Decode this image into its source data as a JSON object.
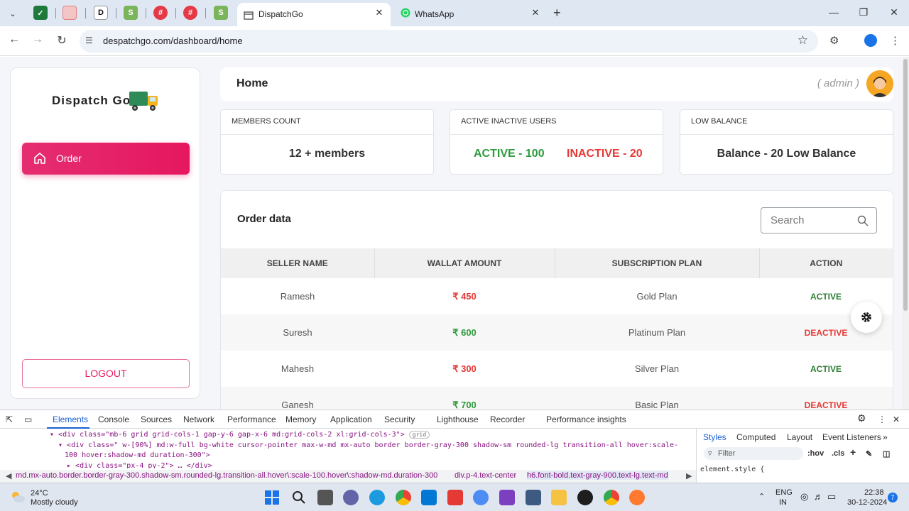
{
  "browser": {
    "tabs": [
      {
        "title": "DispatchGo",
        "active": true
      },
      {
        "title": "WhatsApp",
        "active": false
      }
    ],
    "url": "despatchgo.com/dashboard/home"
  },
  "sidebar": {
    "brand": "Dispatch Go",
    "nav": [
      {
        "label": "Order",
        "icon": "home-icon"
      }
    ],
    "logout_label": "LOGOUT"
  },
  "header": {
    "title": "Home",
    "user_role": "( admin )"
  },
  "stats": [
    {
      "title": "MEMBERS COUNT",
      "value": "12 + members"
    },
    {
      "title": "ACTIVE INACTIVE USERS",
      "active": "ACTIVE - 100",
      "inactive": "INACTIVE - 20"
    },
    {
      "title": "LOW BALANCE",
      "value": "Balance - 20 Low Balance"
    }
  ],
  "orders": {
    "title": "Order data",
    "search_placeholder": "Search",
    "columns": [
      "SELLER NAME",
      "WALLAT AMOUNT",
      "SUBSCRIPTION PLAN",
      "ACTION"
    ],
    "rows": [
      {
        "seller": "Ramesh",
        "amount": "₹ 450",
        "plan": "Gold Plan",
        "action": "ACTIVE"
      },
      {
        "seller": "Suresh",
        "amount": "₹ 600",
        "plan": "Platinum Plan",
        "action": "DEACTIVE"
      },
      {
        "seller": "Mahesh",
        "amount": "₹ 300",
        "plan": "Silver Plan",
        "action": "ACTIVE"
      },
      {
        "seller": "Ganesh",
        "amount": "₹ 700",
        "plan": "Basic Plan",
        "action": "DEACTIVE"
      }
    ]
  },
  "devtools": {
    "tabs": [
      "Elements",
      "Console",
      "Sources",
      "Network",
      "Performance",
      "Memory",
      "Application",
      "Security",
      "Lighthouse",
      "Recorder",
      "Performance insights"
    ],
    "code_lines": [
      "<div class=\"mb-6 grid grid-cols-1 gap-y-6 gap-x-6 md:grid-cols-2 xl:grid-cols-3\">",
      "<div class=\" w-[90%] md:w-full bg-white cursor-pointer max-w-md mx-auto border border-gray-300 shadow-sm rounded-lg transition-all hover:scale-",
      "100 hover:shadow-md duration-300\">",
      "<div class=\"px-4 py-2\"> … </div>"
    ],
    "grid_badge": "grid",
    "breadcrumbs": [
      "md.mx-auto.border.border-gray-300.shadow-sm.rounded-lg.transition-all.hover\\:scale-100.hover\\:shadow-md.duration-300",
      "div.p-4.text-center",
      "h6.font-bold.text-gray-900.text-lg.text-md"
    ],
    "side_tabs": [
      "Styles",
      "Computed",
      "Layout",
      "Event Listeners"
    ],
    "filter_placeholder": "Filter",
    "hov": ":hov",
    "cls": ".cls",
    "element_style": "element.style {"
  },
  "taskbar": {
    "temperature": "24°C",
    "weather": "Mostly cloudy",
    "lang_1": "ENG",
    "lang_2": "IN",
    "time": "22:38",
    "date": "30-12-2024",
    "notifications": "7"
  },
  "colors": {
    "accent": "#e91e63",
    "active_green": "#2e9b3c",
    "inactive_red": "#e53935"
  }
}
